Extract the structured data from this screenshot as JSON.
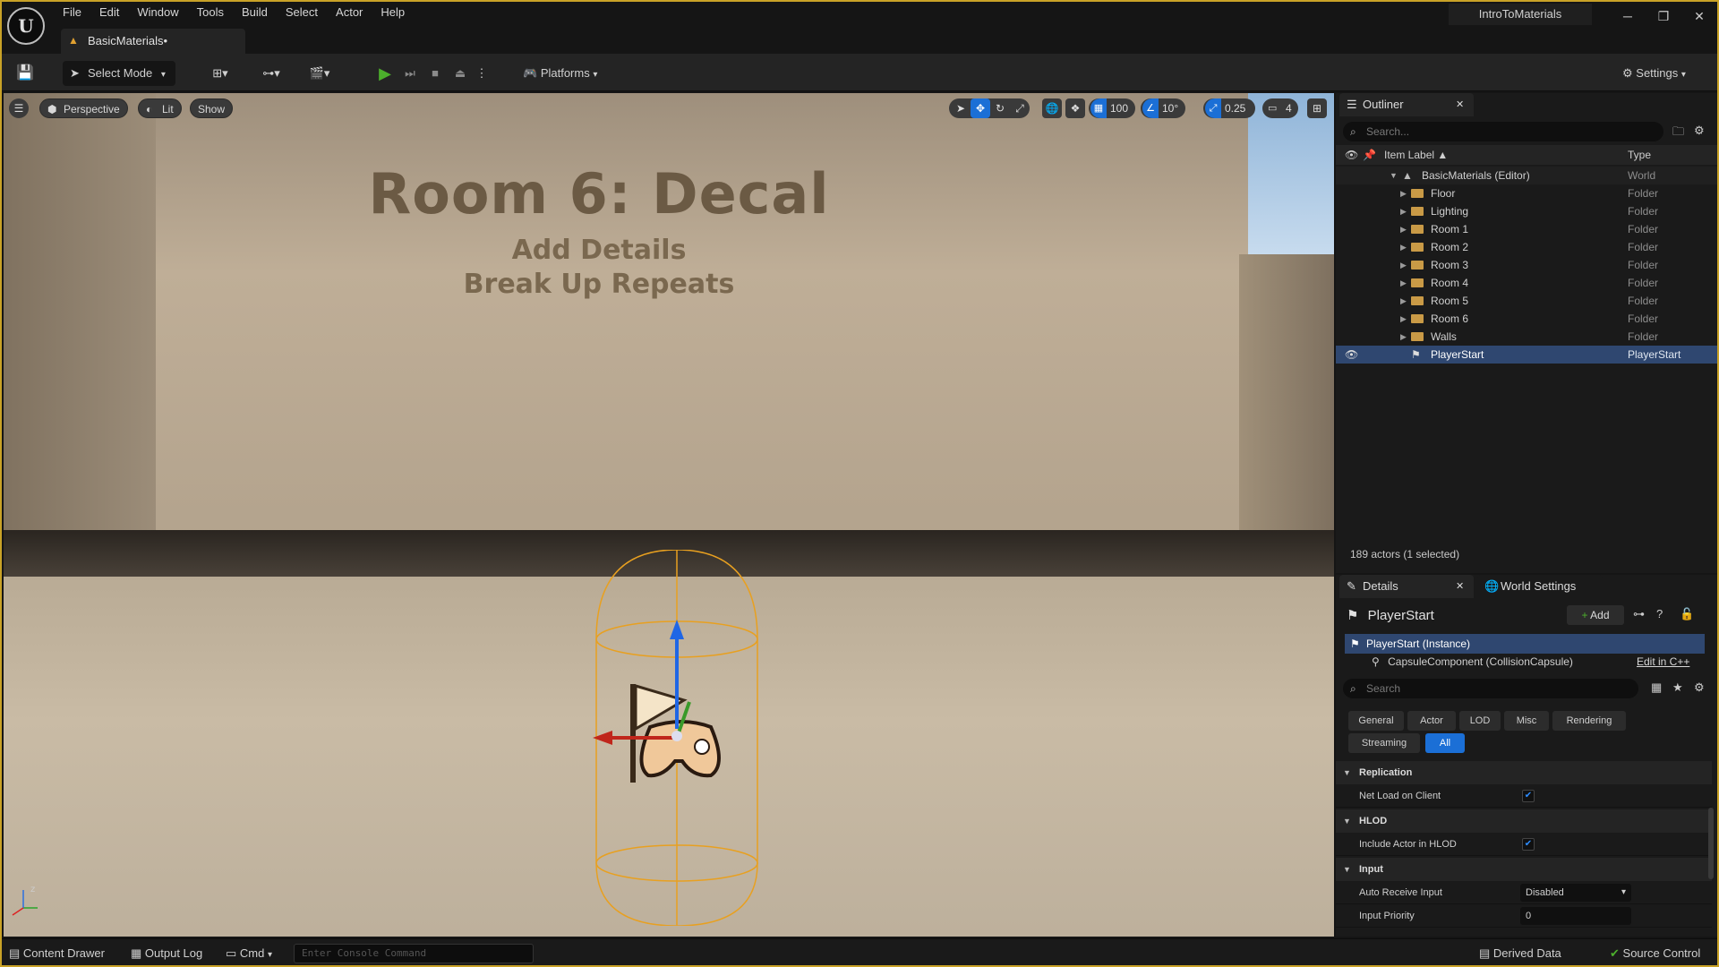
{
  "app": {
    "project_title": "IntroToMaterials",
    "logo": "U"
  },
  "menu": [
    "File",
    "Edit",
    "Window",
    "Tools",
    "Build",
    "Select",
    "Actor",
    "Help"
  ],
  "window_controls": {
    "minimize": "─",
    "restore": "❐",
    "close": "✕"
  },
  "document_tab": {
    "label": "BasicMaterials•"
  },
  "toolbar": {
    "select_mode": "Select Mode",
    "platforms": "Platforms",
    "settings": "Settings"
  },
  "viewport": {
    "perspective": "Perspective",
    "lit": "Lit",
    "show": "Show",
    "grid_snap": "100",
    "rotation_snap": "10°",
    "scale_snap": "0.25",
    "camera_speed": "4",
    "wall_title": "Room 6: Decal",
    "wall_line1": "Add Details",
    "wall_line2": "Break Up Repeats"
  },
  "outliner": {
    "tab_label": "Outliner",
    "search_placeholder": "Search...",
    "col_label": "Item Label ▲",
    "col_type": "Type",
    "root": {
      "label": "BasicMaterials (Editor)",
      "type": "World"
    },
    "items": [
      {
        "label": "Floor",
        "type": "Folder"
      },
      {
        "label": "Lighting",
        "type": "Folder"
      },
      {
        "label": "Room 1",
        "type": "Folder"
      },
      {
        "label": "Room 2",
        "type": "Folder"
      },
      {
        "label": "Room 3",
        "type": "Folder"
      },
      {
        "label": "Room 4",
        "type": "Folder"
      },
      {
        "label": "Room 5",
        "type": "Folder"
      },
      {
        "label": "Room 6",
        "type": "Folder"
      },
      {
        "label": "Walls",
        "type": "Folder"
      }
    ],
    "selected": {
      "label": "PlayerStart",
      "type": "PlayerStart"
    },
    "count": "189 actors (1 selected)"
  },
  "details": {
    "tab_label": "Details",
    "world_settings": "World Settings",
    "actor_name": "PlayerStart",
    "add_label": "Add",
    "instance": "PlayerStart (Instance)",
    "component": "CapsuleComponent (CollisionCapsule)",
    "edit_link": "Edit in C++",
    "search_placeholder": "Search",
    "categories": [
      "General",
      "Actor",
      "LOD",
      "Misc",
      "Rendering",
      "Streaming",
      "All"
    ],
    "sections": {
      "replication": "Replication",
      "net_load": "Net Load on Client",
      "hlod": "HLOD",
      "include_hlod": "Include Actor in HLOD",
      "input": "Input",
      "auto_receive": "Auto Receive Input",
      "auto_receive_value": "Disabled",
      "input_priority": "Input Priority",
      "input_priority_value": "0"
    }
  },
  "statusbar": {
    "content_drawer": "Content Drawer",
    "output_log": "Output Log",
    "cmd": "Cmd",
    "console_placeholder": "Enter Console Command",
    "derived_data": "Derived Data",
    "source_control": "Source Control"
  },
  "colors": {
    "accent": "#1b6fd6",
    "selection_border": "#c9a227",
    "play": "#4caf2c"
  }
}
